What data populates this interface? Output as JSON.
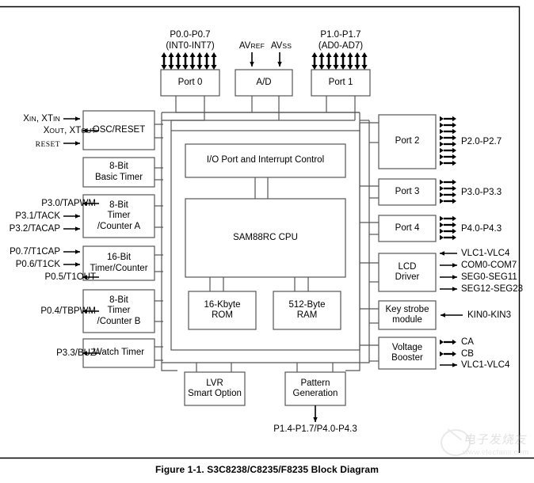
{
  "figure": {
    "caption": "Figure 1-1. S3C8238/C8235/F8235 Block Diagram"
  },
  "watermark": {
    "chinese": "电子发烧友",
    "url": "www.elecfans.com"
  },
  "blocks": {
    "port0": "Port 0",
    "ad": "A/D",
    "port1": "Port 1",
    "osc_reset": "OSC/RESET",
    "basic_timer_l1": "8-Bit",
    "basic_timer_l2": "Basic Timer",
    "timer_a_l1": "8-Bit",
    "timer_a_l2": "Timer",
    "timer_a_l3": "/Counter A",
    "timer16_l1": "16-Bit",
    "timer16_l2": "Timer/Counter",
    "timer_b_l1": "8-Bit",
    "timer_b_l2": "Timer",
    "timer_b_l3": "/Counter B",
    "watch_timer": "Watch Timer",
    "io_port_control": "I/O Port and Interrupt Control",
    "cpu": "SAM88RC CPU",
    "rom_l1": "16-Kbyte",
    "rom_l2": "ROM",
    "ram_l1": "512-Byte",
    "ram_l2": "RAM",
    "lvr_l1": "LVR",
    "lvr_l2": "Smart Option",
    "pattern_l1": "Pattern",
    "pattern_l2": "Generation",
    "port2": "Port 2",
    "port3": "Port 3",
    "port4": "Port 4",
    "lcd_l1": "LCD",
    "lcd_l2": "Driver",
    "key_l1": "Key strobe",
    "key_l2": "module",
    "volt_l1": "Voltage",
    "volt_l2": "Booster"
  },
  "signals": {
    "top": {
      "p0_line1": "P0.0-P0.7",
      "p0_line2": "(INT0-INT7)",
      "avref_main": "AV",
      "avref_sub": "REF",
      "avss_main": "AV",
      "avss_sub": "SS",
      "p1_line1": "P1.0-P1.7",
      "p1_line2": "(AD0-AD7)"
    },
    "left": {
      "xin_a": "X",
      "xin_a_sub": "IN",
      "xin_b": ", XT",
      "xin_b_sub": "IN",
      "xout_a": "X",
      "xout_a_sub": "OUT",
      "xout_b": ", XT",
      "xout_b_sub": "OUT",
      "reset": "RESET",
      "p30_tapwm": "P3.0/TAPWM",
      "p31_tack": "P3.1/TACK",
      "p32_tacap": "P3.2/TACAP",
      "p07_t1cap": "P0.7/T1CAP",
      "p06_t1ck": "P0.6/T1CK",
      "p05_t1out": "P0.5/T1OUT",
      "p04_tbpwm": "P0.4/TBPWM",
      "p33_buz": "P3.3/BUZ"
    },
    "right": {
      "p2": "P2.0-P2.7",
      "p3": "P3.0-P3.3",
      "p4": "P4.0-P4.3",
      "vlc_in": "VLC1-VLC4",
      "com": "COM0-COM7",
      "seg_a": "SEG0-SEG11",
      "seg_b": "SEG12-SEG23",
      "kin": "KIN0-KIN3",
      "ca": "CA",
      "cb": "CB",
      "vlc_out": "VLC1-VLC4"
    },
    "bottom": {
      "pattern_out": "P1.4-P1.7/P4.0-P4.3"
    }
  },
  "colors": {
    "stroke": "#1a1a1a",
    "box_stroke": "#555555",
    "text": "#000000",
    "background": "#ffffff"
  }
}
